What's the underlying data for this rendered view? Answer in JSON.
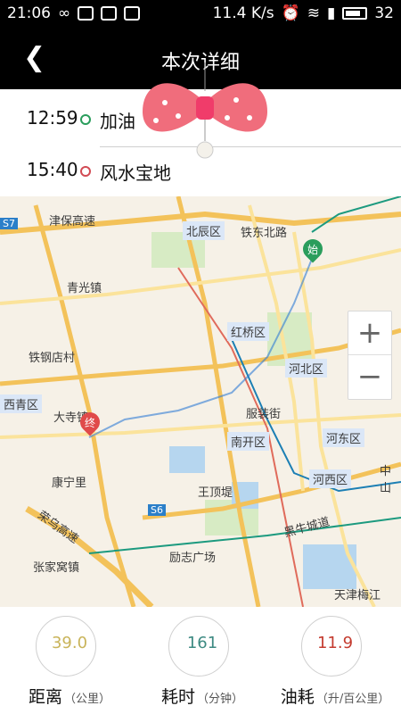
{
  "status_bar": {
    "time": "21:06",
    "speed": "11.4 K/s",
    "battery": "32"
  },
  "header": {
    "title": "本次详细",
    "back_icon": "chevron-left-icon"
  },
  "route": {
    "start": {
      "time": "12:59",
      "place": "加油"
    },
    "end": {
      "time": "15:40",
      "place": "风水宝地"
    }
  },
  "map": {
    "markers": {
      "start": "始",
      "end": "终"
    },
    "labels": [
      "津保高速",
      "北辰区",
      "铁东北路",
      "青光镇",
      "红桥区",
      "铁钢店村",
      "河北区",
      "西青区",
      "大寺镇",
      "服装街",
      "南开区",
      "河东区",
      "康宁里",
      "河西区",
      "王顶堤",
      "荣乌高速",
      "黑牛城道",
      "张家窝镇",
      "励志广场",
      "天津梅江",
      "中山",
      "S6",
      "S7"
    ],
    "zoom_in": "+",
    "zoom_out": "−"
  },
  "stats": [
    {
      "value": "39.0",
      "label": "距离",
      "unit": "（公里）",
      "color": "#c9b45a"
    },
    {
      "value": "161",
      "label": "耗时",
      "unit": "（分钟）",
      "color": "#3d8a82"
    },
    {
      "value": "11.9",
      "label": "油耗",
      "unit": "（升/百公里）",
      "color": "#c43b2f"
    }
  ]
}
